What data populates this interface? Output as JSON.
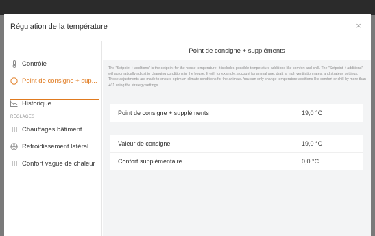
{
  "topbar": {
    "text": ""
  },
  "dialog": {
    "title": "Régulation de la température",
    "close_glyph": "×"
  },
  "sidebar": {
    "items": [
      {
        "label": "Contrôle",
        "icon": "thermometer-icon",
        "glyph": "🌡",
        "active": false
      },
      {
        "label": "Point de consigne + sup...",
        "icon": "info-circle-icon",
        "glyph": "ⓘ",
        "active": true
      },
      {
        "label": "Historique",
        "icon": "chart-icon",
        "glyph": "📈",
        "active": false
      }
    ],
    "section_label": "RÉGLAGES",
    "settings": [
      {
        "label": "Chauffages bâtiment",
        "icon": "heater-icon",
        "glyph": "|||"
      },
      {
        "label": "Refroidissement latéral",
        "icon": "fan-icon",
        "glyph": "✲"
      },
      {
        "label": "Confort vague de chaleur",
        "icon": "heat-wave-icon",
        "glyph": "|||"
      }
    ]
  },
  "content": {
    "title": "Point de consigne + suppléments",
    "description": "The \"Setpoint + additions\" is the setpoint for the house temperature. It includes possible temperature additions like comfort and chill. The \"Setpoint + additions\" will automatically adjust to changing conditions in the house. It will, for example, account for animal age, draft at high ventilation rates, and strategy settings. These adjustments are made to ensure optimum climate conditions for the animals. You can only change temperature additions like comfort or chill by more than +/-1 using the strategy settings.",
    "card1": [
      {
        "label": "Point de consigne + suppléments",
        "value": "19,0 °C"
      }
    ],
    "card2": [
      {
        "label": "Valeur de consigne",
        "value": "19,0 °C"
      },
      {
        "label": "Confort supplémentaire",
        "value": "0,0 °C"
      }
    ]
  },
  "colors": {
    "accent": "#e07a1f",
    "topbar": "#2b2b2b",
    "content_bg": "#f3f4f5"
  }
}
